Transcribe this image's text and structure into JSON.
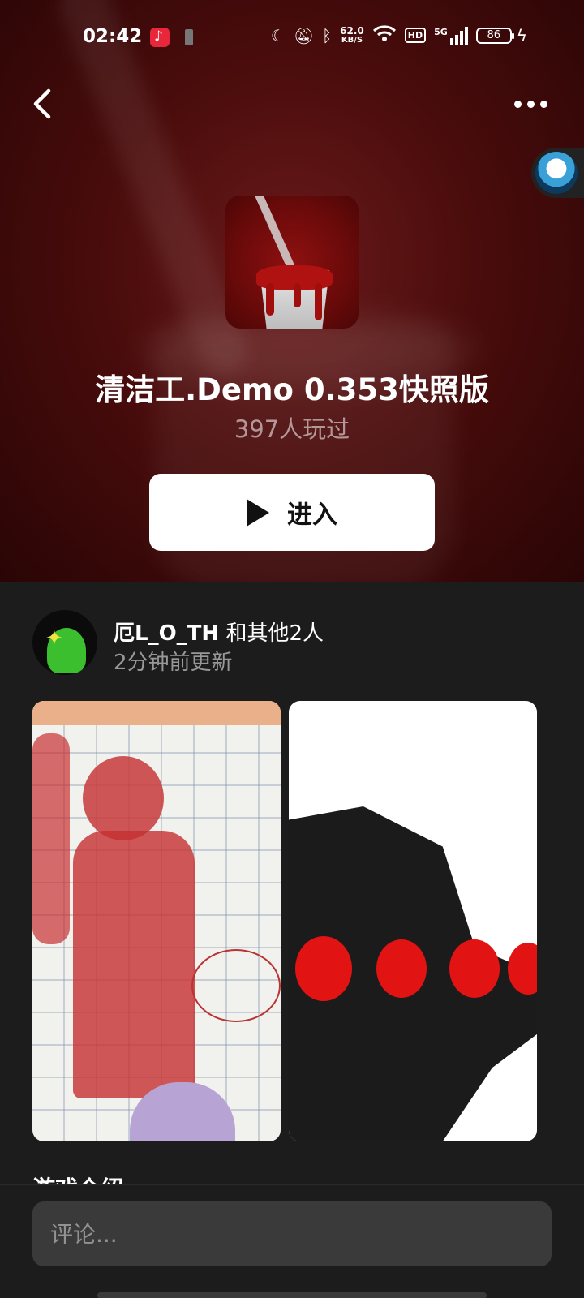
{
  "status_bar": {
    "time": "02:42",
    "net_speed_value": "62.0",
    "net_speed_unit": "KB/S",
    "hd_label": "HD",
    "signal_label": "5G",
    "battery": "86"
  },
  "header": {
    "game_title": "清洁工.Demo 0.353快照版",
    "played_count": "397人玩过",
    "enter_label": "进入"
  },
  "author": {
    "name": "厄L_O_TH",
    "others": "和其他2人",
    "updated": "2分钟前更新"
  },
  "section_peek": "游戏介绍:",
  "comment": {
    "placeholder": "评论..."
  },
  "icons": [
    "back-icon",
    "more-icon",
    "play-icon",
    "moon-icon",
    "mute-icon",
    "bluetooth-icon",
    "wifi-icon",
    "signal-icon",
    "battery-icon",
    "charging-icon",
    "music-app-icon"
  ],
  "colors": {
    "hero_bg": "#4a0c0c",
    "content_bg": "#1c1c1c",
    "button_bg": "#ffffff",
    "input_bg": "#3a3a3a"
  }
}
